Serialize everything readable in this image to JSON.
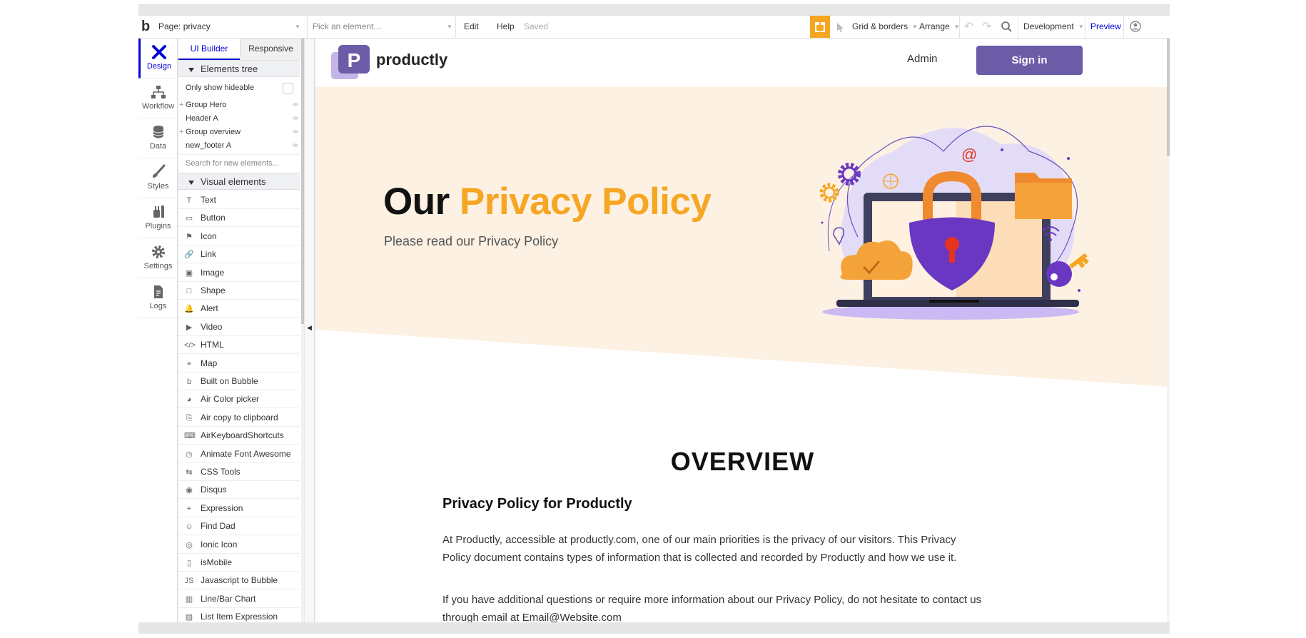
{
  "topbar": {
    "logo": "b",
    "page_selector": "Page: privacy",
    "element_picker_placeholder": "Pick an element...",
    "edit": "Edit",
    "help": "Help",
    "saved": "Saved",
    "grid": "Grid & borders",
    "arrange": "Arrange",
    "environment": "Development",
    "preview": "Preview",
    "icons": [
      "gift-icon",
      "cursor-icon",
      "undo-icon",
      "redo-icon",
      "search-icon",
      "account-icon"
    ]
  },
  "leftnav": [
    {
      "label": "Design",
      "icon": "design-icon",
      "active": true
    },
    {
      "label": "Workflow",
      "icon": "workflow-icon"
    },
    {
      "label": "Data",
      "icon": "data-icon"
    },
    {
      "label": "Styles",
      "icon": "brush-icon"
    },
    {
      "label": "Plugins",
      "icon": "plugins-icon"
    },
    {
      "label": "Settings",
      "icon": "gear-icon"
    },
    {
      "label": "Logs",
      "icon": "document-icon"
    }
  ],
  "panel": {
    "tabs": [
      "UI Builder",
      "Responsive"
    ],
    "elements_tree": "Elements tree",
    "only_show_hideable": "Only show hideable",
    "tree": [
      "Group Hero",
      "Header A",
      "Group overview",
      "new_footer A"
    ],
    "search_placeholder": "Search for new elements...",
    "visual_elements": "Visual elements",
    "items": [
      {
        "label": "Text",
        "icon": "T"
      },
      {
        "label": "Button",
        "icon": "▭"
      },
      {
        "label": "Icon",
        "icon": "⚑"
      },
      {
        "label": "Link",
        "icon": "🔗"
      },
      {
        "label": "Image",
        "icon": "▣"
      },
      {
        "label": "Shape",
        "icon": "□"
      },
      {
        "label": "Alert",
        "icon": "🔔"
      },
      {
        "label": "Video",
        "icon": "▶"
      },
      {
        "label": "HTML",
        "icon": "</>"
      },
      {
        "label": "Map",
        "icon": "⌖"
      },
      {
        "label": "Built on Bubble",
        "icon": "b"
      },
      {
        "label": "Air Color picker",
        "icon": "◕"
      },
      {
        "label": "Air copy to clipboard",
        "icon": "⎘"
      },
      {
        "label": "AirKeyboardShortcuts",
        "icon": "⌨"
      },
      {
        "label": "Animate Font Awesome",
        "icon": "◷"
      },
      {
        "label": "CSS Tools",
        "icon": "⇆"
      },
      {
        "label": "Disqus",
        "icon": "◉"
      },
      {
        "label": "Expression",
        "icon": "+"
      },
      {
        "label": "Find Dad",
        "icon": "☺"
      },
      {
        "label": "Ionic Icon",
        "icon": "◎"
      },
      {
        "label": "isMobile",
        "icon": "▯"
      },
      {
        "label": "Javascript to Bubble",
        "icon": "JS"
      },
      {
        "label": "Line/Bar Chart",
        "icon": "▥"
      },
      {
        "label": "List Item Expression",
        "icon": "▤"
      }
    ]
  },
  "page": {
    "brand": "productly",
    "brand_logo": "P",
    "admin": "Admin",
    "sign_in": "Sign in",
    "hero_title_1": "Our",
    "hero_title_2": "Privacy Policy",
    "hero_subtitle": "Please read our Privacy Policy",
    "overview": "OVERVIEW",
    "section_title": "Privacy Policy for Productly",
    "para1_line1": "At Productly, accessible at productly.com, one of our main priorities is the privacy of our visitors. This Privacy",
    "para1_line2": "Policy document contains types of information that is collected and recorded by Productly and how we use it.",
    "para2_line1": "If you have additional questions or require more information about our Privacy Policy, do not hesitate to contact us",
    "para2_line2": "through email at Email@Website.com",
    "at_symbol": "@"
  },
  "colors": {
    "accent": "#0205d3",
    "brand_purple": "#6c5ca7",
    "orange": "#f6a623",
    "hero_bg": "#fdf1e3"
  }
}
